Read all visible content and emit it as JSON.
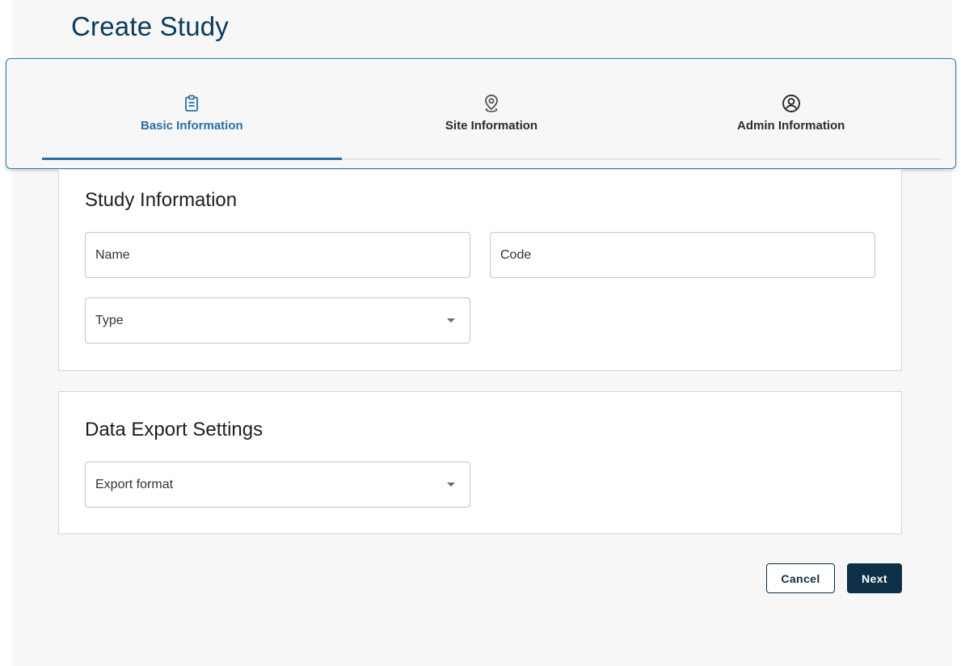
{
  "page": {
    "title": "Create Study"
  },
  "stepper": {
    "active_index": 0,
    "accent_color": "#2a6fa8",
    "tabs": [
      {
        "label": "Basic Information",
        "icon": "clipboard-icon"
      },
      {
        "label": "Site Information",
        "icon": "location-pin-icon"
      },
      {
        "label": "Admin Information",
        "icon": "user-circle-icon"
      }
    ]
  },
  "study_information": {
    "title": "Study Information",
    "name_label": "Name",
    "code_label": "Code",
    "type_label": "Type"
  },
  "data_export": {
    "title": "Data Export Settings",
    "format_label": "Export format"
  },
  "actions": {
    "cancel_label": "Cancel",
    "next_label": "Next",
    "primary_color": "#0d2f47"
  }
}
